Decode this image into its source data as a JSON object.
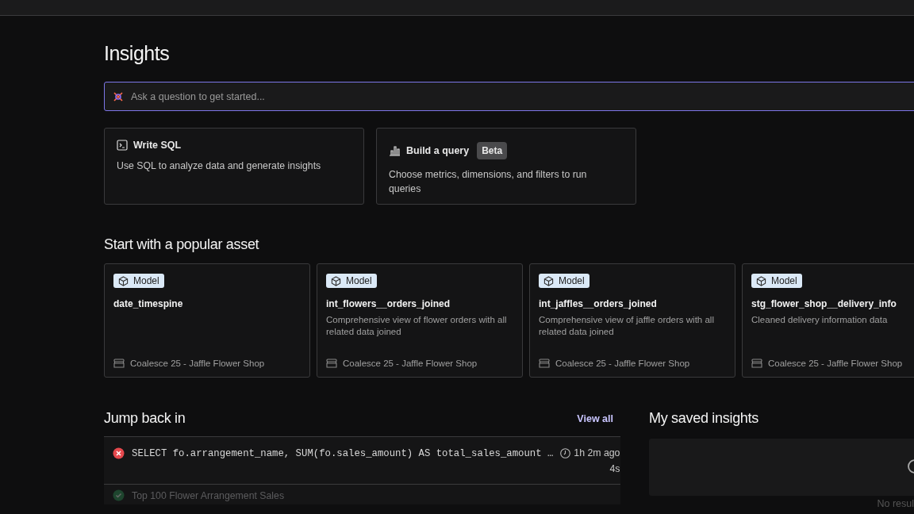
{
  "page": {
    "title": "Insights"
  },
  "ask": {
    "placeholder": "Ask a question to get started..."
  },
  "actions": [
    {
      "kind": "sql",
      "title": "Write SQL",
      "description": "Use SQL to analyze data and generate insights"
    },
    {
      "kind": "query",
      "title": "Build a query",
      "badge": "Beta",
      "description": "Choose metrics, dimensions, and filters to run queries"
    }
  ],
  "popular": {
    "title": "Start with a popular asset",
    "assets": [
      {
        "type": "Model",
        "name": "date_timespine",
        "project": "Coalesce 25 - Jaffle Flower Shop"
      },
      {
        "type": "Model",
        "name": "int_flowers__orders_joined",
        "description": "Comprehensive view of flower orders with all related data joined",
        "project": "Coalesce 25 - Jaffle Flower Shop"
      },
      {
        "type": "Model",
        "name": "int_jaffles__orders_joined",
        "description": "Comprehensive view of jaffle orders with all related data joined",
        "project": "Coalesce 25 - Jaffle Flower Shop"
      },
      {
        "type": "Model",
        "name": "stg_flower_shop__delivery_info",
        "description": "Cleaned delivery information data",
        "project": "Coalesce 25 - Jaffle Flower Shop"
      }
    ]
  },
  "recent": {
    "title": "Jump back in",
    "link": "View all",
    "rows": [
      {
        "kind": "error",
        "text": "SELECT fo.arrangement_name, SUM(fo.sales_amount) AS total_sales_amount …",
        "time": "1h 2m ago",
        "duration": "4s"
      },
      {
        "kind": "success",
        "text": "Top 100 Flower Arrangement Sales"
      }
    ]
  },
  "saved": {
    "title": "My saved insights",
    "empty_text": "No resul"
  }
}
